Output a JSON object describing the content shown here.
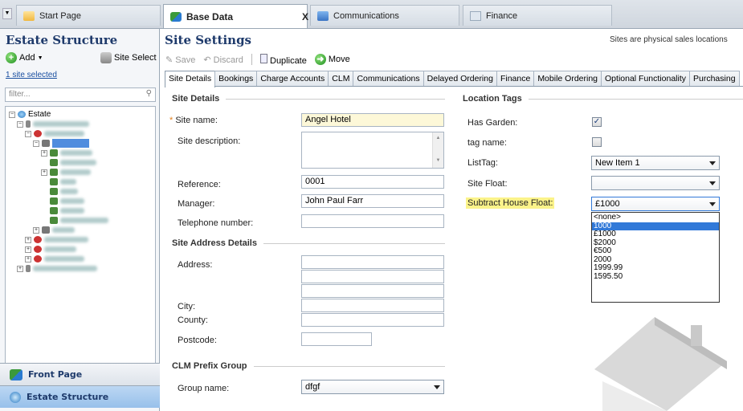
{
  "tabs": [
    {
      "label": "Start Page"
    },
    {
      "label": "Base Data",
      "close": "X"
    },
    {
      "label": "Communications"
    },
    {
      "label": "Finance"
    }
  ],
  "left": {
    "title": "Estate Structure",
    "add": "Add",
    "site_select": "Site Select",
    "selected": "1 site selected",
    "filter_placeholder": "filter...",
    "tree_root": "Estate",
    "nav": {
      "front_page": "Front Page",
      "estate_structure": "Estate Structure"
    }
  },
  "main": {
    "title": "Site Settings",
    "description": "Sites are physical sales locations",
    "toolbar": {
      "save": "Save",
      "discard": "Discard",
      "duplicate": "Duplicate",
      "move": "Move"
    },
    "tabs": [
      "Site Details",
      "Bookings",
      "Charge Accounts",
      "CLM",
      "Communications",
      "Delayed Ordering",
      "Finance",
      "Mobile Ordering",
      "Optional Functionality",
      "Purchasing"
    ],
    "site_details": {
      "heading": "Site Details",
      "site_name_label": "Site name:",
      "site_name": "Angel Hotel",
      "site_desc_label": "Site description:",
      "reference_label": "Reference:",
      "reference": "0001",
      "manager_label": "Manager:",
      "manager": "John Paul Farr",
      "telephone_label": "Telephone number:"
    },
    "address": {
      "heading": "Site Address Details",
      "address_label": "Address:",
      "city_label": "City:",
      "county_label": "County:",
      "postcode_label": "Postcode:"
    },
    "clm": {
      "heading": "CLM Prefix Group",
      "group_label": "Group name:",
      "group_value": "dfgf"
    },
    "location_tags": {
      "heading": "Location Tags",
      "has_garden_label": "Has Garden:",
      "has_garden": true,
      "tag_name_label": "tag name:",
      "tag_name": false,
      "list_tag_label": "ListTag:",
      "list_tag_value": "New Item 1",
      "site_float_label": "Site Float:",
      "site_float_value": "",
      "subtract_label": "Subtract House Float:",
      "subtract_value": "£1000",
      "options": [
        "<none>",
        "1000",
        "£1000",
        "$2000",
        "€500",
        "2000",
        "1999.99",
        "1595.50"
      ],
      "highlighted_index": 1
    }
  }
}
